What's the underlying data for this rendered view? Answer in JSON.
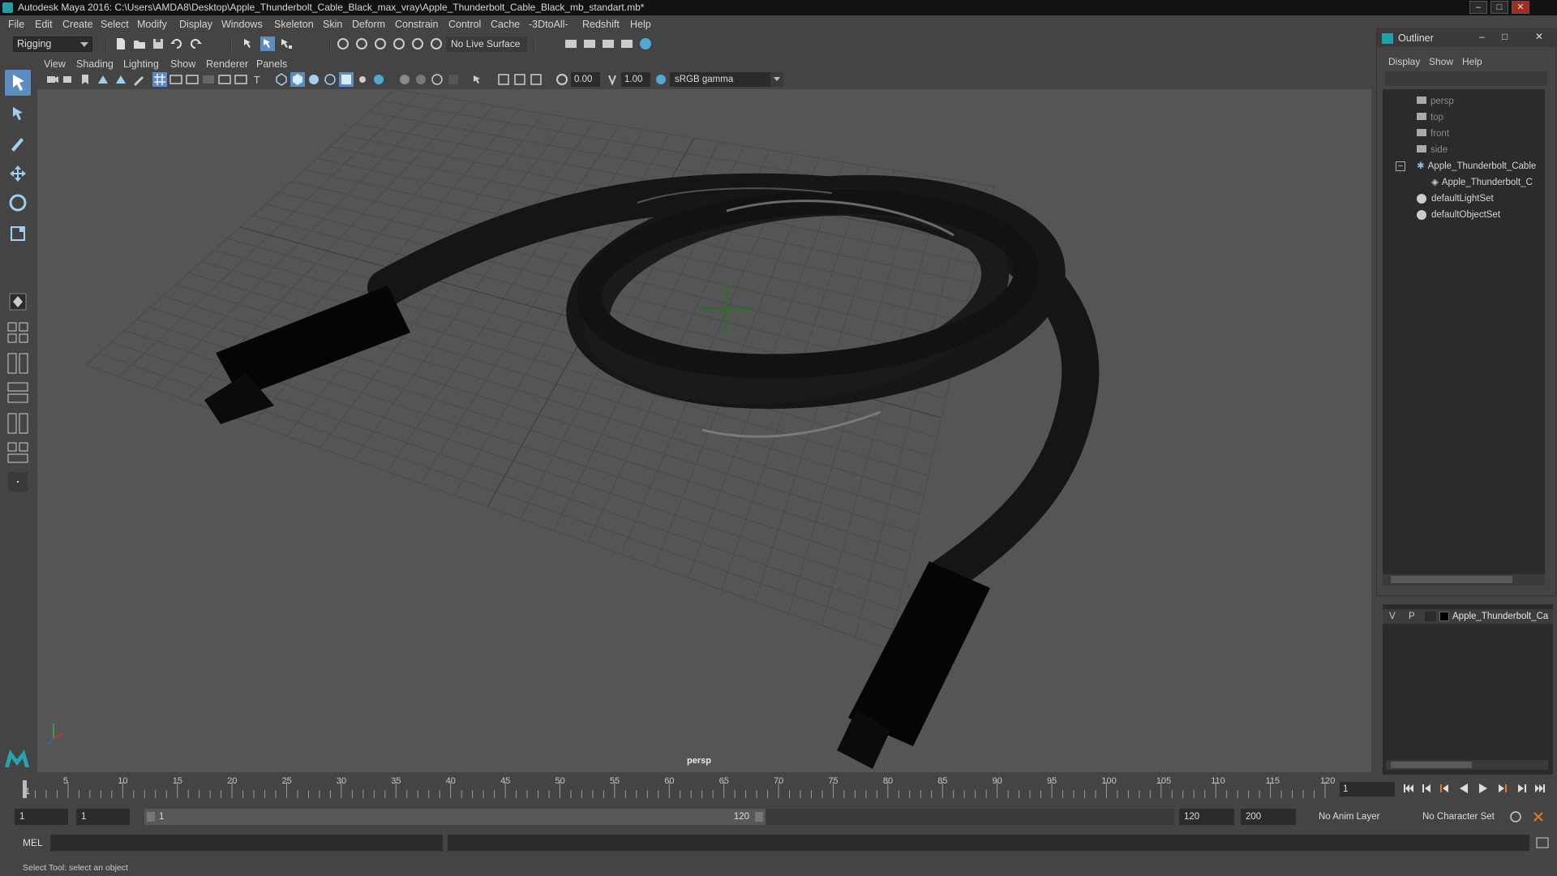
{
  "window": {
    "title": "Autodesk Maya 2016: C:\\Users\\AMDA8\\Desktop\\Apple_Thunderbolt_Cable_Black_max_vray\\Apple_Thunderbolt_Cable_Black_mb_standart.mb*"
  },
  "menubar": {
    "items": [
      "File",
      "Edit",
      "Create",
      "Select",
      "Modify",
      "Display",
      "Windows",
      "Skeleton",
      "Skin",
      "Deform",
      "Constrain",
      "Control",
      "Cache",
      "-3DtoAll-",
      "Redshift",
      "Help"
    ]
  },
  "shelf": {
    "mode": "Rigging",
    "live_surface": "No Live Surface"
  },
  "panel": {
    "menus": [
      "View",
      "Shading",
      "Lighting",
      "Show",
      "Renderer",
      "Panels"
    ],
    "exposure": "0.00",
    "gamma_value": "1.00",
    "color_space": "sRGB gamma",
    "camera_label": "persp"
  },
  "outliner": {
    "title": "Outliner",
    "menus": [
      "Display",
      "Show",
      "Help"
    ],
    "items": [
      {
        "label": "persp",
        "icon": "camera-icon"
      },
      {
        "label": "top",
        "icon": "camera-icon"
      },
      {
        "label": "front",
        "icon": "camera-icon"
      },
      {
        "label": "side",
        "icon": "camera-icon"
      },
      {
        "label": "Apple_Thunderbolt_Cable",
        "icon": "group-icon"
      },
      {
        "label": "Apple_Thunderbolt_C",
        "icon": "mesh-icon"
      },
      {
        "label": "defaultLightSet",
        "icon": "set-icon"
      },
      {
        "label": "defaultObjectSet",
        "icon": "set-icon"
      }
    ]
  },
  "layers": {
    "v": "V",
    "p": "P",
    "name": "Apple_Thunderbolt_Ca"
  },
  "timeline": {
    "ticks": [
      "1",
      "5",
      "10",
      "15",
      "20",
      "25",
      "30",
      "35",
      "40",
      "45",
      "50",
      "55",
      "60",
      "65",
      "70",
      "75",
      "80",
      "85",
      "90",
      "95",
      "100",
      "105",
      "110",
      "115",
      "120"
    ],
    "current_frame": "1"
  },
  "range": {
    "start": "1",
    "playback_start": "1",
    "slider_start": "1",
    "slider_end": "120",
    "playback_end": "120",
    "end": "200",
    "anim_layer": "No Anim Layer",
    "character_set": "No Character Set"
  },
  "command": {
    "language": "MEL"
  },
  "help_line": "Select Tool: select an object",
  "colors": {
    "viewport_bg": "#555555",
    "active_tool": "#5d8dc0",
    "cable": "#141414"
  }
}
